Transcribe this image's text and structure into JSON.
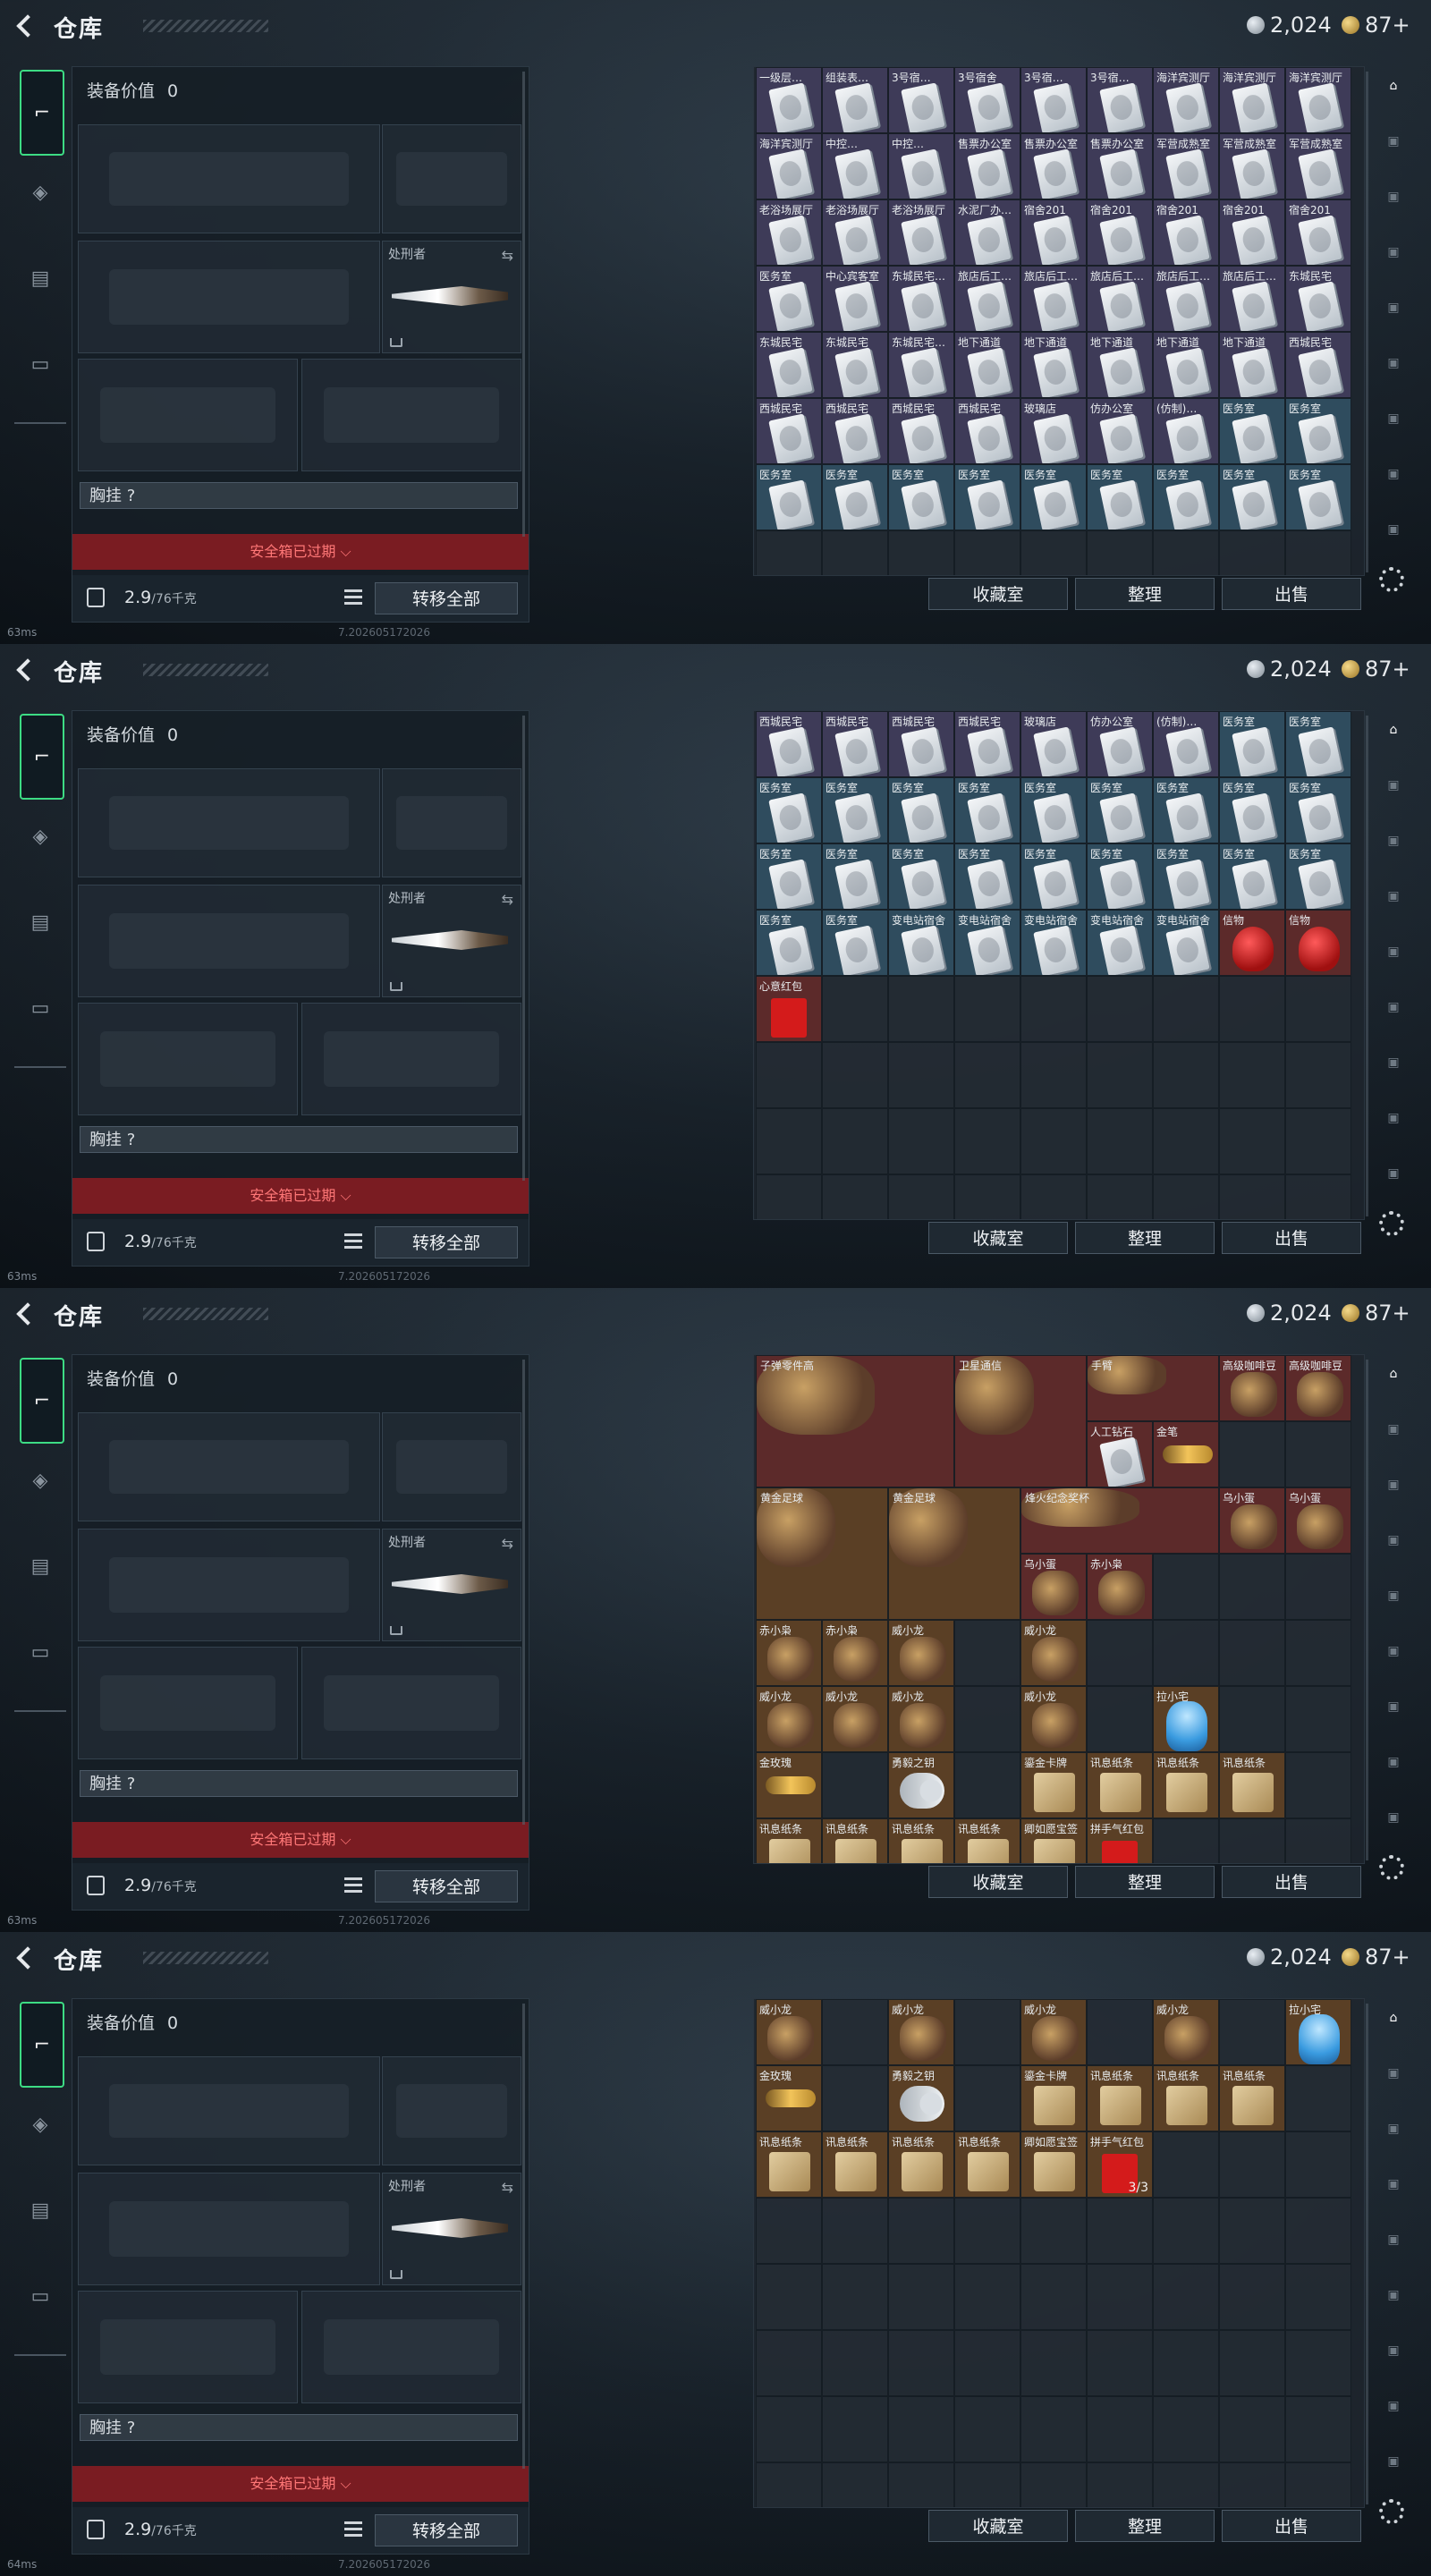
{
  "screen": {
    "title": "仓库",
    "silver": "2,024",
    "gold": "87+",
    "equipment_value_label": "装备价值",
    "equipment_value": "0",
    "melee_slot_label": "处刑者",
    "rig_label": "胸挂 ?",
    "safebox_expired": "安全箱已过期 ⌵",
    "weight": "2.9",
    "weight_max": "/76千克",
    "transfer_all": "转移全部",
    "actions": [
      "收藏室",
      "整理",
      "出售"
    ],
    "ping_a": "63ms",
    "ping_b": "64ms",
    "build": "7.202605172026"
  },
  "colors": {
    "purple": "#3e3b58",
    "blue": "#2f4c5e",
    "red": "#5c2a2a",
    "gold": "#5a3f25",
    "active_green": "#3ddc84"
  },
  "frames": [
    {
      "rows": [
        [
          [
            "一级层…",
            "purple",
            "card"
          ],
          [
            "组装表…",
            "purple",
            "card"
          ],
          [
            "3号宿…",
            "purple",
            "card"
          ],
          [
            "3号宿舍",
            "purple",
            "card"
          ],
          [
            "3号宿…",
            "purple",
            "card"
          ],
          [
            "3号宿…",
            "purple",
            "card"
          ],
          [
            "海洋宾测厅",
            "purple",
            "card"
          ],
          [
            "海洋宾测厅",
            "purple",
            "card"
          ],
          [
            "海洋宾测厅",
            "purple",
            "card"
          ]
        ],
        [
          [
            "海洋宾测厅",
            "purple",
            "card"
          ],
          [
            "中控…",
            "purple",
            "card"
          ],
          [
            "中控…",
            "purple",
            "card"
          ],
          [
            "售票办公室",
            "purple",
            "card"
          ],
          [
            "售票办公室",
            "purple",
            "card"
          ],
          [
            "售票办公室",
            "purple",
            "card"
          ],
          [
            "军营成熟室",
            "purple",
            "card"
          ],
          [
            "军营成熟室",
            "purple",
            "card"
          ],
          [
            "军营成熟室",
            "purple",
            "card"
          ]
        ],
        [
          [
            "老浴场展厅",
            "purple",
            "card"
          ],
          [
            "老浴场展厅",
            "purple",
            "card"
          ],
          [
            "老浴场展厅",
            "purple",
            "card"
          ],
          [
            "水泥厂办…",
            "purple",
            "card"
          ],
          [
            "宿舍201",
            "purple",
            "card"
          ],
          [
            "宿舍201",
            "purple",
            "card"
          ],
          [
            "宿舍201",
            "purple",
            "card"
          ],
          [
            "宿舍201",
            "purple",
            "card"
          ],
          [
            "宿舍201",
            "purple",
            "card"
          ]
        ],
        [
          [
            "医务室",
            "purple",
            "card"
          ],
          [
            "中心宾客室",
            "purple",
            "card"
          ],
          [
            "东城民宅…",
            "purple",
            "card"
          ],
          [
            "旅店后工…",
            "purple",
            "card"
          ],
          [
            "旅店后工…",
            "purple",
            "card"
          ],
          [
            "旅店后工…",
            "purple",
            "card"
          ],
          [
            "旅店后工…",
            "purple",
            "card"
          ],
          [
            "旅店后工…",
            "purple",
            "card"
          ],
          [
            "东城民宅",
            "purple",
            "card"
          ]
        ],
        [
          [
            "东城民宅",
            "purple",
            "card"
          ],
          [
            "东城民宅",
            "purple",
            "card"
          ],
          [
            "东城民宅…",
            "purple",
            "card"
          ],
          [
            "地下通道",
            "purple",
            "card"
          ],
          [
            "地下通道",
            "purple",
            "card"
          ],
          [
            "地下通道",
            "purple",
            "card"
          ],
          [
            "地下通道",
            "purple",
            "card"
          ],
          [
            "地下通道",
            "purple",
            "card"
          ],
          [
            "西城民宅",
            "purple",
            "card"
          ]
        ],
        [
          [
            "西城民宅",
            "purple",
            "card"
          ],
          [
            "西城民宅",
            "purple",
            "card"
          ],
          [
            "西城民宅",
            "purple",
            "card"
          ],
          [
            "西城民宅",
            "purple",
            "card"
          ],
          [
            "玻璃店",
            "purple",
            "card"
          ],
          [
            "仿办公室",
            "purple",
            "card"
          ],
          [
            "(仿制)…",
            "purple",
            "card"
          ],
          [
            "医务室",
            "blue",
            "card"
          ],
          [
            "医务室",
            "blue",
            "card"
          ]
        ],
        [
          [
            "医务室",
            "blue",
            "card"
          ],
          [
            "医务室",
            "blue",
            "card"
          ],
          [
            "医务室",
            "blue",
            "card"
          ],
          [
            "医务室",
            "blue",
            "card"
          ],
          [
            "医务室",
            "blue",
            "card"
          ],
          [
            "医务室",
            "blue",
            "card"
          ],
          [
            "医务室",
            "blue",
            "card"
          ],
          [
            "医务室",
            "blue",
            "card"
          ],
          [
            "医务室",
            "blue",
            "card"
          ]
        ]
      ]
    },
    {
      "rows": [
        [
          [
            "西城民宅",
            "purple",
            "card"
          ],
          [
            "西城民宅",
            "purple",
            "card"
          ],
          [
            "西城民宅",
            "purple",
            "card"
          ],
          [
            "西城民宅",
            "purple",
            "card"
          ],
          [
            "玻璃店",
            "purple",
            "card"
          ],
          [
            "仿办公室",
            "purple",
            "card"
          ],
          [
            "(仿制)…",
            "purple",
            "card"
          ],
          [
            "医务室",
            "blue",
            "card"
          ],
          [
            "医务室",
            "blue",
            "card"
          ]
        ],
        [
          [
            "医务室",
            "blue",
            "card"
          ],
          [
            "医务室",
            "blue",
            "card"
          ],
          [
            "医务室",
            "blue",
            "card"
          ],
          [
            "医务室",
            "blue",
            "card"
          ],
          [
            "医务室",
            "blue",
            "card"
          ],
          [
            "医务室",
            "blue",
            "card"
          ],
          [
            "医务室",
            "blue",
            "card"
          ],
          [
            "医务室",
            "blue",
            "card"
          ],
          [
            "医务室",
            "blue",
            "card"
          ]
        ],
        [
          [
            "医务室",
            "blue",
            "card"
          ],
          [
            "医务室",
            "blue",
            "card"
          ],
          [
            "医务室",
            "blue",
            "card"
          ],
          [
            "医务室",
            "blue",
            "card"
          ],
          [
            "医务室",
            "blue",
            "card"
          ],
          [
            "医务室",
            "blue",
            "card"
          ],
          [
            "医务室",
            "blue",
            "card"
          ],
          [
            "医务室",
            "blue",
            "card"
          ],
          [
            "医务室",
            "blue",
            "card"
          ]
        ],
        [
          [
            "医务室",
            "blue",
            "card"
          ],
          [
            "医务室",
            "blue",
            "card"
          ],
          [
            "变电站宿舍",
            "blue",
            "card"
          ],
          [
            "变电站宿舍",
            "blue",
            "card"
          ],
          [
            "变电站宿舍",
            "blue",
            "card"
          ],
          [
            "变电站宿舍",
            "blue",
            "card"
          ],
          [
            "变电站宿舍",
            "blue",
            "card"
          ],
          [
            "信物",
            "red",
            "mask"
          ],
          [
            "信物",
            "red",
            "mask"
          ]
        ],
        [
          [
            "心意红包",
            "red",
            "redenv"
          ]
        ]
      ]
    },
    {
      "big": [
        {
          "label": "子弹零件高",
          "col": 0,
          "row": 0,
          "w": 3,
          "h": 2,
          "color": "red"
        },
        {
          "label": "卫星通信",
          "col": 3,
          "row": 0,
          "w": 2,
          "h": 2,
          "color": "red"
        },
        {
          "label": "手臂",
          "col": 5,
          "row": 0,
          "w": 2,
          "h": 1,
          "color": "red"
        },
        {
          "label": "黄金足球",
          "col": 0,
          "row": 2,
          "w": 2,
          "h": 2,
          "color": "gold"
        },
        {
          "label": "黄金足球",
          "col": 2,
          "row": 2,
          "w": 2,
          "h": 2,
          "color": "gold"
        },
        {
          "label": "烽火纪念奖杯",
          "col": 4,
          "row": 2,
          "w": 3,
          "h": 1,
          "color": "red"
        }
      ],
      "rows": [
        [
          null,
          null,
          null,
          null,
          null,
          null,
          null,
          [
            "高级咖啡豆",
            "red",
            "toy"
          ],
          [
            "高级咖啡豆",
            "red",
            "toy"
          ]
        ],
        [
          null,
          null,
          null,
          null,
          null,
          [
            "人工钻石",
            "red",
            "card"
          ],
          [
            "金笔",
            "red",
            "rose"
          ],
          null,
          null
        ],
        [
          null,
          null,
          null,
          null,
          null,
          null,
          null,
          [
            "乌小蛋",
            "red",
            "toy"
          ],
          [
            "乌小蛋",
            "red",
            "toy"
          ]
        ],
        [
          null,
          null,
          null,
          null,
          [
            "乌小蛋",
            "red",
            "toy"
          ],
          [
            "赤小枭",
            "red",
            "toy"
          ],
          null,
          null,
          null
        ],
        [
          [
            "赤小枭",
            "gold",
            "toy"
          ],
          [
            "赤小枭",
            "gold",
            "toy"
          ],
          [
            "威小龙",
            "gold",
            "toy"
          ],
          null,
          [
            "威小龙",
            "gold",
            "toy"
          ],
          null,
          null,
          null,
          null
        ],
        [
          [
            "威小龙",
            "gold",
            "toy"
          ],
          [
            "威小龙",
            "gold",
            "toy"
          ],
          [
            "威小龙",
            "gold",
            "toy"
          ],
          null,
          [
            "威小龙",
            "gold",
            "toy"
          ],
          null,
          [
            "拉小宅",
            "gold",
            "blue"
          ],
          null,
          null
        ],
        [
          [
            "金玫瑰",
            "gold",
            "rose"
          ],
          null,
          [
            "勇毅之钥",
            "gold",
            "key"
          ],
          null,
          [
            "鎏金卡牌",
            "gold",
            "paper"
          ],
          [
            "讯息纸条",
            "gold",
            "paper"
          ],
          [
            "讯息纸条",
            "gold",
            "paper"
          ],
          [
            "讯息纸条",
            "gold",
            "paper"
          ],
          null
        ],
        [
          [
            "讯息纸条",
            "gold",
            "paper"
          ],
          [
            "讯息纸条",
            "gold",
            "paper"
          ],
          [
            "讯息纸条",
            "gold",
            "paper"
          ],
          [
            "讯息纸条",
            "gold",
            "paper"
          ],
          [
            "卿如愿宝签",
            "gold",
            "paper"
          ],
          [
            "拼手气红包",
            "gold",
            "redenv"
          ],
          null,
          null,
          null
        ]
      ]
    },
    {
      "rows": [
        [
          [
            "威小龙",
            "gold",
            "toy"
          ],
          null,
          [
            "威小龙",
            "gold",
            "toy"
          ],
          null,
          [
            "威小龙",
            "gold",
            "toy"
          ],
          null,
          [
            "威小龙",
            "gold",
            "toy"
          ],
          null,
          [
            "拉小宅",
            "gold",
            "blue"
          ]
        ],
        [
          [
            "金玫瑰",
            "gold",
            "rose"
          ],
          null,
          [
            "勇毅之钥",
            "gold",
            "key"
          ],
          null,
          [
            "鎏金卡牌",
            "gold",
            "paper"
          ],
          [
            "讯息纸条",
            "gold",
            "paper"
          ],
          [
            "讯息纸条",
            "gold",
            "paper"
          ],
          [
            "讯息纸条",
            "gold",
            "paper"
          ],
          null
        ],
        [
          [
            "讯息纸条",
            "gold",
            "paper"
          ],
          [
            "讯息纸条",
            "gold",
            "paper"
          ],
          [
            "讯息纸条",
            "gold",
            "paper"
          ],
          [
            "讯息纸条",
            "gold",
            "paper"
          ],
          [
            "卿如愿宝签",
            "gold",
            "paper"
          ],
          [
            "拼手气红包",
            "gold",
            "redenv"
          ]
        ]
      ],
      "qty": "3/3"
    }
  ]
}
